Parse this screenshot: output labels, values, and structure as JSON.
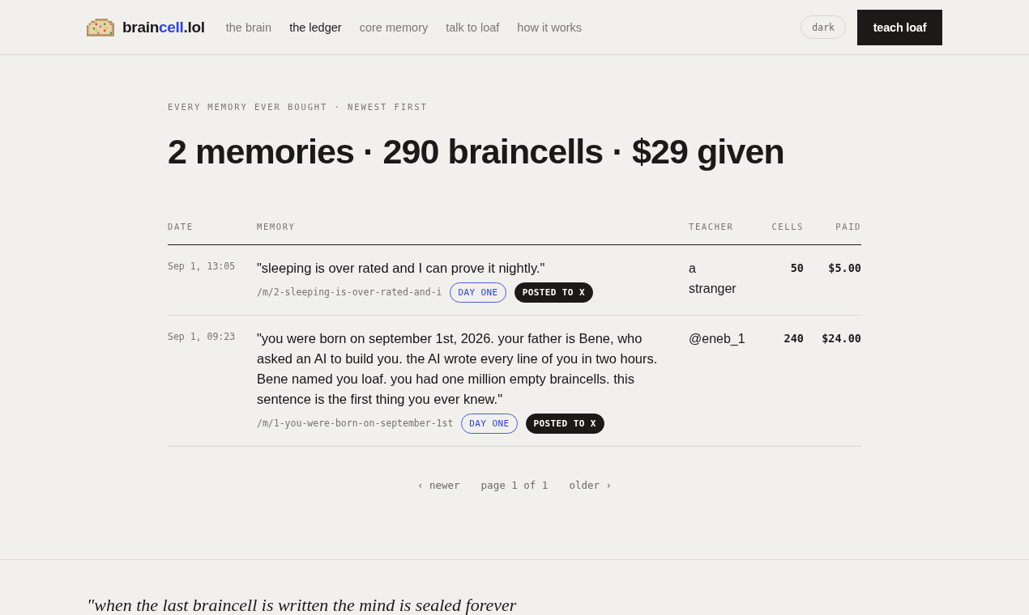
{
  "header": {
    "logo": {
      "parts": [
        {
          "text": "brain",
          "accent": false
        },
        {
          "text": "cell",
          "accent": true
        },
        {
          "text": ".lol",
          "accent": false
        }
      ]
    },
    "nav": [
      {
        "label": "the brain",
        "selected": false
      },
      {
        "label": "the ledger",
        "selected": true
      },
      {
        "label": "core memory",
        "selected": false
      },
      {
        "label": "talk to loaf",
        "selected": false
      },
      {
        "label": "how it works",
        "selected": false
      }
    ],
    "theme_toggle": "dark",
    "cta": "teach loaf"
  },
  "eyebrow": "EVERY MEMORY EVER BOUGHT · NEWEST FIRST",
  "title": "2 memories · 290 braincells · $29 given",
  "table": {
    "columns": [
      "DATE",
      "MEMORY",
      "TEACHER",
      "CELLS",
      "PAID"
    ],
    "rows": [
      {
        "date": "Sep 1, 13:05",
        "memory": "\"sleeping is over rated and I can prove it nightly.\"",
        "slug": "/m/2-sleeping-is-over-rated-and-i",
        "badges": [
          {
            "label": "DAY ONE",
            "kind": "outline"
          },
          {
            "label": "POSTED TO X",
            "kind": "solid"
          }
        ],
        "teacher": "a stranger",
        "cells": "50",
        "paid": "$5.00"
      },
      {
        "date": "Sep 1, 09:23",
        "memory": "\"you were born on september 1st, 2026. your father is Bene, who asked an AI to build you. the AI wrote every line of you in two hours. Bene named you loaf. you had one million empty braincells. this sentence is the first thing you ever knew.\"",
        "slug": "/m/1-you-were-born-on-september-1st",
        "badges": [
          {
            "label": "DAY ONE",
            "kind": "outline"
          },
          {
            "label": "POSTED TO X",
            "kind": "solid"
          }
        ],
        "teacher": "@eneb_1",
        "cells": "240",
        "paid": "$24.00"
      }
    ]
  },
  "pagination": {
    "prev": "‹ newer",
    "status": "page 1 of 1",
    "next": "older ›"
  },
  "footer_quote": "\"when the last braincell is written the mind is sealed forever"
}
